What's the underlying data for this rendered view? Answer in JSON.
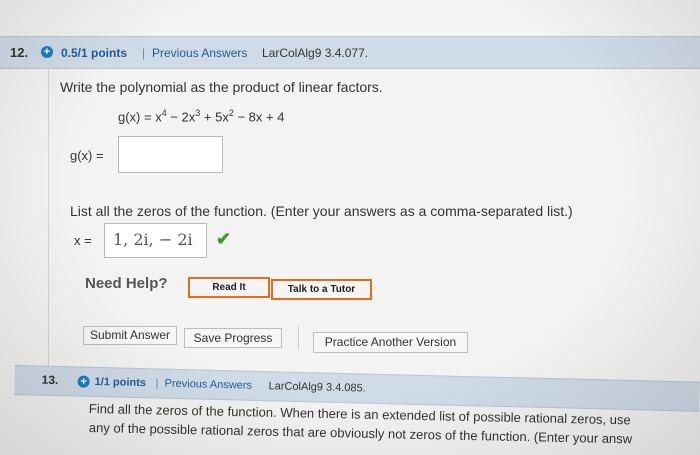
{
  "q12": {
    "number": "12.",
    "status_glyph": "+",
    "points": "0.5/1 points",
    "separator": "|",
    "previous_answers": "Previous Answers",
    "reference": "LarColAlg9 3.4.077.",
    "instruction": "Write the polynomial as the product of linear factors.",
    "function_label": "g(x) = x",
    "exp4": "4",
    "term2": " − 2x",
    "exp3": "3",
    "term3": " + 5x",
    "exp2": "2",
    "term4": " − 8x + 4",
    "answer_label": "g(x) =",
    "answer_value": "",
    "zeros_prompt": "List all the zeros of the function. (Enter your answers as a comma-separated list.)",
    "zeros_label": "x =",
    "zeros_value": "1, 2i, − 2i",
    "correct_glyph": "✔",
    "need_help": "Need Help?",
    "read_it": "Read It",
    "talk_tutor": "Talk to a Tutor",
    "submit": "Submit Answer",
    "save": "Save Progress",
    "practice": "Practice Another Version"
  },
  "q13": {
    "number": "13.",
    "status_glyph": "+",
    "points": "1/1 points",
    "separator": "|",
    "previous_answers": "Previous Answers",
    "reference": "LarColAlg9 3.4.085.",
    "line1": "Find all the zeros of the function. When there is an extended list of possible rational zeros, use",
    "line2": "any of the possible rational zeros that are obviously not zeros of the function. (Enter your answ"
  },
  "colors": {
    "header_bg": "#cfdbe7",
    "link_blue": "#1f5d99",
    "status_blue": "#1e7fc0",
    "correct_green": "#3b9b2f",
    "tool_border": "#e56d1a"
  }
}
